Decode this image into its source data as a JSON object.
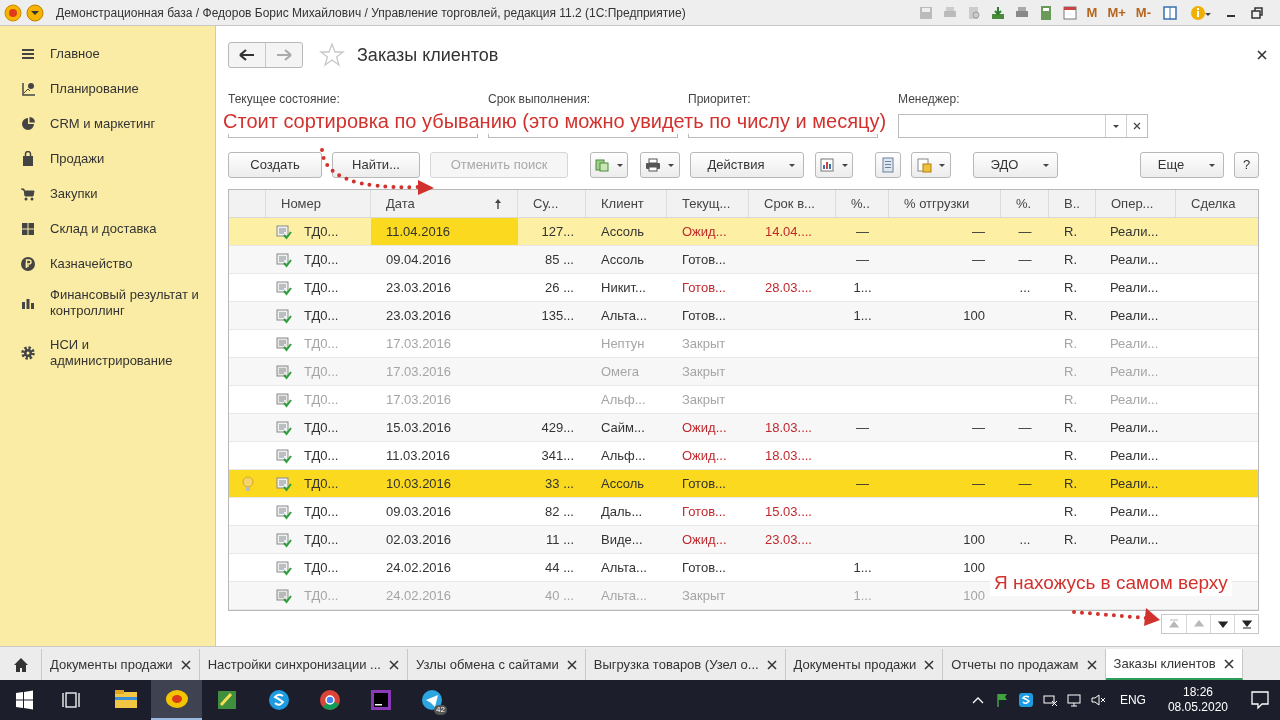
{
  "title_bar": {
    "title": "Демонстрационная база / Федоров Борис Михайлович / Управление торговлей, редакция 11.2  (1С:Предприятие)",
    "memory_buttons": [
      "M",
      "M+",
      "M-"
    ]
  },
  "sidebar": {
    "items": [
      {
        "label": "Главное",
        "kind": "menu"
      },
      {
        "label": "Планирование",
        "kind": "planning"
      },
      {
        "label": "CRM и маркетинг",
        "kind": "pie"
      },
      {
        "label": "Продажи",
        "kind": "bag"
      },
      {
        "label": "Закупки",
        "kind": "cart"
      },
      {
        "label": "Склад и доставка",
        "kind": "grid"
      },
      {
        "label": "Казначейство",
        "kind": "coin"
      },
      {
        "label": "Финансовый результат и контроллинг",
        "kind": "bars"
      },
      {
        "label": "НСИ и администрирование",
        "kind": "gear"
      }
    ]
  },
  "form": {
    "title": "Заказы клиентов"
  },
  "filters": [
    {
      "label": "Текущее состояние:"
    },
    {
      "label": "Срок выполнения:"
    },
    {
      "label": "Приоритет:"
    },
    {
      "label": "Менеджер:"
    }
  ],
  "toolbar": [
    {
      "kind": "button",
      "label": "Создать",
      "disabled": false
    },
    {
      "kind": "button",
      "label": "Найти...",
      "disabled": false
    },
    {
      "kind": "button",
      "label": "Отменить поиск",
      "disabled": true
    },
    {
      "kind": "documents",
      "disabled": false
    },
    {
      "kind": "print",
      "disabled": false
    },
    {
      "kind": "menu_button",
      "label": "Действия",
      "disabled": false
    },
    {
      "kind": "report",
      "disabled": false
    },
    {
      "kind": "list",
      "disabled": false
    },
    {
      "kind": "attach",
      "disabled": false
    },
    {
      "kind": "menu_button",
      "label": "ЭДО",
      "disabled": false
    },
    {
      "kind": "menu_button",
      "label": "Еще",
      "disabled": false
    },
    {
      "kind": "button",
      "label": "?",
      "disabled": false
    }
  ],
  "table": {
    "columns": [
      {
        "label": "Номер",
        "sorted": false
      },
      {
        "label": "Дата",
        "sorted": true
      },
      {
        "label": "Су...",
        "sorted": false
      },
      {
        "label": "Клиент",
        "sorted": false
      },
      {
        "label": "Текущ...",
        "sorted": false
      },
      {
        "label": "Срок в...",
        "sorted": false
      },
      {
        "label": "%..",
        "sorted": false
      },
      {
        "label": "% отгрузки",
        "sorted": false
      },
      {
        "label": "%.",
        "sorted": false
      },
      {
        "label": "В..",
        "sorted": false
      },
      {
        "label": "Опер...",
        "sorted": false
      },
      {
        "label": "Сделка",
        "sorted": false
      }
    ],
    "rows": [
      {
        "selected": true,
        "hint": false,
        "closed": false,
        "overdue": true,
        "cells": {
          "number": "ТД0...",
          "date": "11.04.2016",
          "sum": "127...",
          "client": "Ассоль",
          "state": "Ожид...",
          "deadline": "14.04....",
          "pay": "—",
          "ship": "—",
          "pct": "—",
          "v": "R.",
          "op": "Реали..."
        }
      },
      {
        "selected": false,
        "hint": false,
        "closed": false,
        "overdue": false,
        "cells": {
          "number": "ТД0...",
          "date": "09.04.2016",
          "sum": "85 ...",
          "client": "Ассоль",
          "state": "Готов...",
          "pay": "—",
          "ship": "—",
          "pct": "—",
          "v": "R.",
          "op": "Реали..."
        }
      },
      {
        "selected": false,
        "hint": false,
        "closed": false,
        "overdue": true,
        "cells": {
          "number": "ТД0...",
          "date": "23.03.2016",
          "sum": "26 ...",
          "client": "Никит...",
          "state": "Готов...",
          "deadline": "28.03....",
          "pay": "1...",
          "pct": "...",
          "v": "R.",
          "op": "Реали..."
        }
      },
      {
        "selected": false,
        "hint": false,
        "closed": false,
        "overdue": false,
        "cells": {
          "number": "ТД0...",
          "date": "23.03.2016",
          "sum": "135...",
          "client": "Альта...",
          "state": "Готов...",
          "pay": "1...",
          "ship": "100",
          "v": "R.",
          "op": "Реали..."
        }
      },
      {
        "selected": false,
        "hint": false,
        "closed": true,
        "overdue": false,
        "cells": {
          "number": "ТД0...",
          "date": "17.03.2016",
          "client": "Нептун",
          "state": "Закрыт",
          "v": "R.",
          "op": "Реали..."
        }
      },
      {
        "selected": false,
        "hint": false,
        "closed": true,
        "overdue": false,
        "cells": {
          "number": "ТД0...",
          "date": "17.03.2016",
          "client": "Омега",
          "state": "Закрыт",
          "v": "R.",
          "op": "Реали..."
        }
      },
      {
        "selected": false,
        "hint": false,
        "closed": true,
        "overdue": false,
        "cells": {
          "number": "ТД0...",
          "date": "17.03.2016",
          "client": "Альф...",
          "state": "Закрыт",
          "v": "R.",
          "op": "Реали..."
        }
      },
      {
        "selected": false,
        "hint": false,
        "closed": false,
        "overdue": true,
        "cells": {
          "number": "ТД0...",
          "date": "15.03.2016",
          "sum": "429...",
          "client": "Сайм...",
          "state": "Ожид...",
          "deadline": "18.03....",
          "pay": "—",
          "ship": "—",
          "pct": "—",
          "v": "R.",
          "op": "Реали..."
        }
      },
      {
        "selected": false,
        "hint": false,
        "closed": false,
        "overdue": true,
        "cells": {
          "number": "ТД0...",
          "date": "11.03.2016",
          "sum": "341...",
          "client": "Альф...",
          "state": "Ожид...",
          "deadline": "18.03....",
          "v": "R.",
          "op": "Реали..."
        }
      },
      {
        "selected": false,
        "hint": true,
        "closed": false,
        "overdue": false,
        "cells": {
          "number": "ТД0...",
          "date": "10.03.2016",
          "sum": "33 ...",
          "client": "Ассоль",
          "state": "Готов...",
          "pay": "—",
          "ship": "—",
          "pct": "—",
          "v": "R.",
          "op": "Реали..."
        }
      },
      {
        "selected": false,
        "hint": false,
        "closed": false,
        "overdue": true,
        "cells": {
          "number": "ТД0...",
          "date": "09.03.2016",
          "sum": "82 ...",
          "client": "Даль...",
          "state": "Готов...",
          "deadline": "15.03....",
          "v": "R.",
          "op": "Реали..."
        }
      },
      {
        "selected": false,
        "hint": false,
        "closed": false,
        "overdue": true,
        "cells": {
          "number": "ТД0...",
          "date": "02.03.2016",
          "sum": "11 ...",
          "client": "Виде...",
          "state": "Ожид...",
          "deadline": "23.03....",
          "ship": "100",
          "pct": "...",
          "v": "R.",
          "op": "Реали..."
        }
      },
      {
        "selected": false,
        "hint": false,
        "closed": false,
        "overdue": false,
        "cells": {
          "number": "ТД0...",
          "date": "24.02.2016",
          "sum": "44 ...",
          "client": "Альта...",
          "state": "Готов...",
          "pay": "1...",
          "ship": "100"
        }
      },
      {
        "selected": false,
        "hint": false,
        "closed": true,
        "overdue": false,
        "cells": {
          "number": "ТД0...",
          "date": "24.02.2016",
          "sum": "40 ...",
          "client": "Альта...",
          "state": "Закрыт",
          "pay": "1...",
          "ship": "100"
        }
      }
    ]
  },
  "scroll_buttons": [
    {
      "kind": "first",
      "disabled": true
    },
    {
      "kind": "up",
      "disabled": true
    },
    {
      "kind": "down",
      "disabled": false
    },
    {
      "kind": "last",
      "disabled": false
    }
  ],
  "annotations": [
    {
      "text": "Стоит сортировка по убыванию (это можно увидеть по числу и месяцу)"
    },
    {
      "text": "Я нахожусь в самом верху"
    }
  ],
  "tabs": [
    {
      "label": "Документы продажи",
      "selected": false
    },
    {
      "label": "Настройки синхронизации ...",
      "selected": false
    },
    {
      "label": "Узлы обмена с сайтами",
      "selected": false
    },
    {
      "label": "Выгрузка товаров (Узел о...",
      "selected": false
    },
    {
      "label": "Документы продажи",
      "selected": false
    },
    {
      "label": "Отчеты по продажам",
      "selected": false
    },
    {
      "label": "Заказы клиентов",
      "selected": true
    }
  ],
  "taskbar": {
    "apps": [
      {
        "kind": "explorer",
        "active": false
      },
      {
        "kind": "onec",
        "active": true
      },
      {
        "kind": "editor",
        "active": false
      },
      {
        "kind": "skype",
        "active": false
      },
      {
        "kind": "chrome",
        "active": false
      },
      {
        "kind": "phpstorm",
        "active": false
      },
      {
        "kind": "telegram",
        "active": false,
        "badge": "42"
      }
    ],
    "language": "ENG",
    "time": "18:26",
    "date": "08.05.2020"
  }
}
